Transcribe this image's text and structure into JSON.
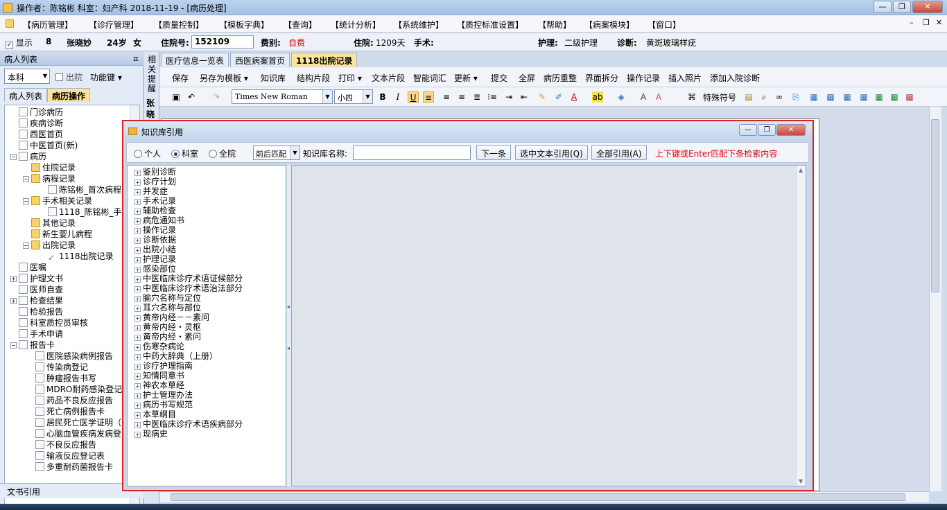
{
  "titlebar": {
    "text": "操作者：陈铭彬  科室：妇产科  2018-11-19 - [病历处理]"
  },
  "window_buttons": {
    "minimize": "—",
    "restore": "❐",
    "close": "✕"
  },
  "menu": [
    "【病历管理】",
    "【诊疗管理】",
    "【质量控制】",
    "【模板字典】",
    "【查询】",
    "【统计分析】",
    "【系统维护】",
    "【质控标准设置】",
    "【帮助】",
    "【病案模块】",
    "【窗口】"
  ],
  "mdi_buttons": [
    "–",
    "❐",
    "✕"
  ],
  "patient": {
    "show_label": "显示",
    "bed": "8",
    "name": "张晓妙",
    "age": "24岁",
    "sex": "女",
    "admission_no_label": "住院号:",
    "admission_no": "152109",
    "fee_type_label": "费别:",
    "fee_type": "自费",
    "stay_label": "住院:",
    "stay_days": "1209天",
    "surgery_label": "手术:",
    "nursing_label": "护理:",
    "nursing": "二级护理",
    "diagnosis_label": "诊断:",
    "diagnosis": "黄斑玻璃样疣"
  },
  "left_panel": {
    "header": "病人列表",
    "dept_select": "本科",
    "discharged_label": "出院",
    "function_key": "功能键",
    "tabs": [
      "病人列表",
      "病历操作"
    ],
    "status": "文书引用",
    "tree": [
      {
        "label": "门诊病历"
      },
      {
        "label": "疾病诊断"
      },
      {
        "label": "西医首页"
      },
      {
        "label": "中医首页(新)"
      },
      {
        "label": "病历"
      },
      {
        "label": "住院记录"
      },
      {
        "label": "病程记录"
      },
      {
        "label": "陈铭彬_首次病程"
      },
      {
        "label": "手术相关记录"
      },
      {
        "label": "1118_陈铭彬_手"
      },
      {
        "label": "其他记录"
      },
      {
        "label": "新生婴儿病程"
      },
      {
        "label": "出院记录"
      },
      {
        "label": "1118出院记录"
      },
      {
        "label": "医嘱"
      },
      {
        "label": "护理文书"
      },
      {
        "label": "医师自查"
      },
      {
        "label": "检查结果"
      },
      {
        "label": "检验报告"
      },
      {
        "label": "科室质控员审核"
      },
      {
        "label": "手术申请"
      },
      {
        "label": "报告卡"
      },
      {
        "label": "医院感染病例报告"
      },
      {
        "label": "传染病登记"
      },
      {
        "label": "肿瘤报告书写"
      },
      {
        "label": "MDRO耐药感染登记"
      },
      {
        "label": "药品不良反应报告"
      },
      {
        "label": "死亡病例报告卡"
      },
      {
        "label": "居民死亡医学证明（"
      },
      {
        "label": "心脑血管疾病发病登"
      },
      {
        "label": "不良反应报告"
      },
      {
        "label": "输液反应登记表"
      },
      {
        "label": "多重耐药菌报告卡"
      }
    ]
  },
  "side_strip": {
    "text": "相关提醒",
    "name": "张晓"
  },
  "doc_tabs": [
    "医疗信息一览表",
    "西医病案首页",
    "1118出院记录"
  ],
  "toolbar1": [
    "保存",
    "另存为模板 ▾",
    "知识库",
    "结构片段",
    "打印 ▾",
    "文本片段",
    "智能词汇",
    "更新 ▾",
    "提交",
    "全屏",
    "病历重整",
    "界面拆分",
    "操作记录",
    "插入照片",
    "添加入院诊断"
  ],
  "toolbar2": {
    "font": "Times New Roman",
    "size": "小四",
    "special_symbol": "特殊符号"
  },
  "dialog": {
    "title": "知识库引用",
    "scope_options": [
      "个人",
      "科室",
      "全院"
    ],
    "scope_selected": "科室",
    "match_mode": "前后匹配",
    "kb_name_label": "知识库名称:",
    "kb_name_value": "",
    "next_button": "下一条",
    "cite_selected_button": "选中文本引用(Q)",
    "cite_all_button": "全部引用(A)",
    "hint": "上下键或Enter匹配下条检索内容",
    "hint_color": "#e00000",
    "items": [
      "鉴别诊断",
      "诊疗计划",
      "并发症",
      "手术记录",
      "辅助检查",
      "病危通知书",
      "操作记录",
      "诊断依据",
      "出院小结",
      "护理记录",
      "感染部位",
      "中医临床诊疗术语证候部分",
      "中医临床诊疗术语治法部分",
      "腧穴名称与定位",
      "耳穴名称与部位",
      "黄帝内经－－素问",
      "黄帝内经・灵枢",
      "黄帝内经・素问",
      "伤寒杂病论",
      "中药大辞典（上册）",
      "诊疗护理指南",
      "知情同意书",
      "神农本草经",
      "护士管理办法",
      "病历书写规范",
      "本草纲目",
      "中医临床诊疗术语疾病部分",
      "现病史"
    ]
  }
}
